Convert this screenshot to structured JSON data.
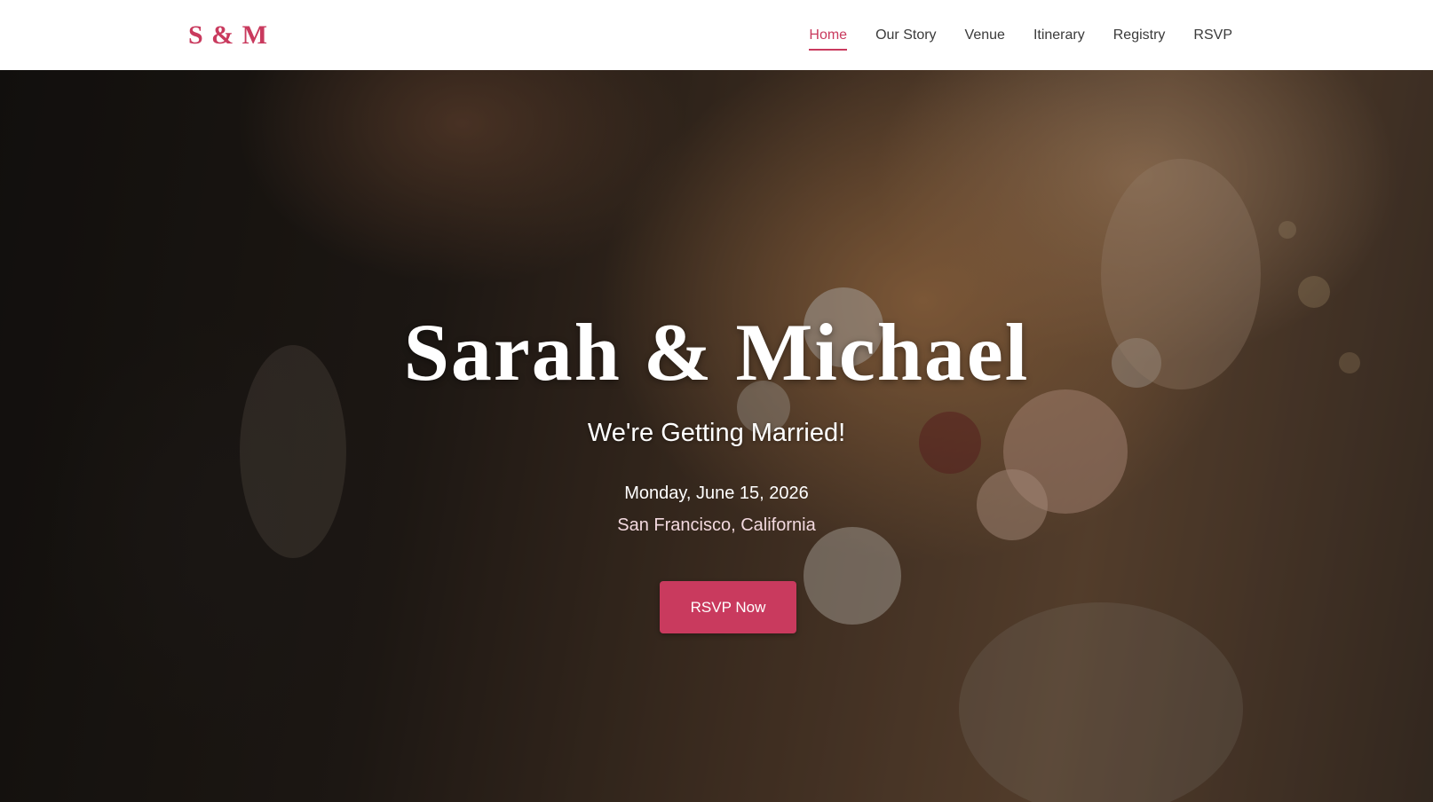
{
  "brand": {
    "logo": "S & M",
    "accent_color": "#c93a5e"
  },
  "nav": {
    "items": [
      {
        "label": "Home",
        "active": true
      },
      {
        "label": "Our Story",
        "active": false
      },
      {
        "label": "Venue",
        "active": false
      },
      {
        "label": "Itinerary",
        "active": false
      },
      {
        "label": "Registry",
        "active": false
      },
      {
        "label": "RSVP",
        "active": false
      }
    ]
  },
  "hero": {
    "title": "Sarah & Michael",
    "subtitle": "We're Getting Married!",
    "date": "Monday, June 15, 2026",
    "location": "San Francisco, California",
    "cta_label": "RSVP Now",
    "background_image": "wedding-bouquet-photo"
  }
}
